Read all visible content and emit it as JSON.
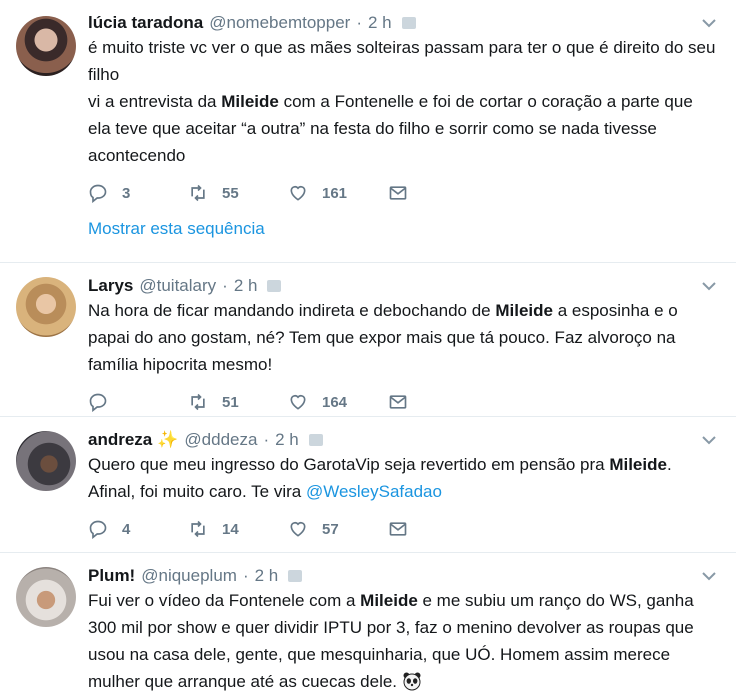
{
  "tweets": [
    {
      "name": "lúcia taradona",
      "handle": "@nomebemtopper",
      "time": "2 h",
      "lines": [
        "é muito triste vc ver o que as mães solteiras passam para ter o que é direito do seu filho",
        "vi a entrevista da ",
        "Mileide",
        " com a Fontenelle e foi de cortar o coração a parte que ela teve que aceitar “a outra” na festa do filho e sorrir como se nada tivesse acontecendo"
      ],
      "replies": "3",
      "retweets": "55",
      "likes": "161",
      "thread_link": "Mostrar esta sequência"
    },
    {
      "name": "Larys",
      "handle": "@tuitalary",
      "time": "2 h",
      "text_a": "Na hora de ficar mandando indireta e debochando de ",
      "bold": "Mileide",
      "text_b": " a esposinha e o papai do ano gostam, né? Tem que expor mais que tá pouco. Faz alvoroço na família hipocrita mesmo!",
      "replies": "",
      "retweets": "51",
      "likes": "164"
    },
    {
      "name": "andreza",
      "handle": "@dddeza",
      "time": "2 h",
      "text_a": "Quero que meu ingresso do GarotaVip seja revertido em pensão pra ",
      "bold": "Mileide",
      "text_b": ". Afinal, foi muito caro. Te vira ",
      "mention": "@WesleySafadao",
      "replies": "4",
      "retweets": "14",
      "likes": "57"
    },
    {
      "name": "Plum!",
      "handle": "@niqueplum",
      "time": "2 h",
      "text_a": "Fui ver o vídeo da Fontenele com a ",
      "bold": "Mileide",
      "text_b": " e me subiu um ranço do WS, ganha 300 mil por show e quer dividir IPTU por 3, faz o menino devolver as roupas que usou na casa dele, gente, que mesquinharia, que UÓ. Homem assim merece mulher que arranque até as cuecas dele. "
    }
  ],
  "sep": "·",
  "colors": {
    "link": "#1b95e0",
    "muted": "#657786",
    "divider": "#e6ecf0"
  },
  "icons": [
    "reply-icon",
    "retweet-icon",
    "like-icon",
    "message-icon",
    "chevron-down-icon",
    "sparkles-icon",
    "panda-emoji"
  ]
}
